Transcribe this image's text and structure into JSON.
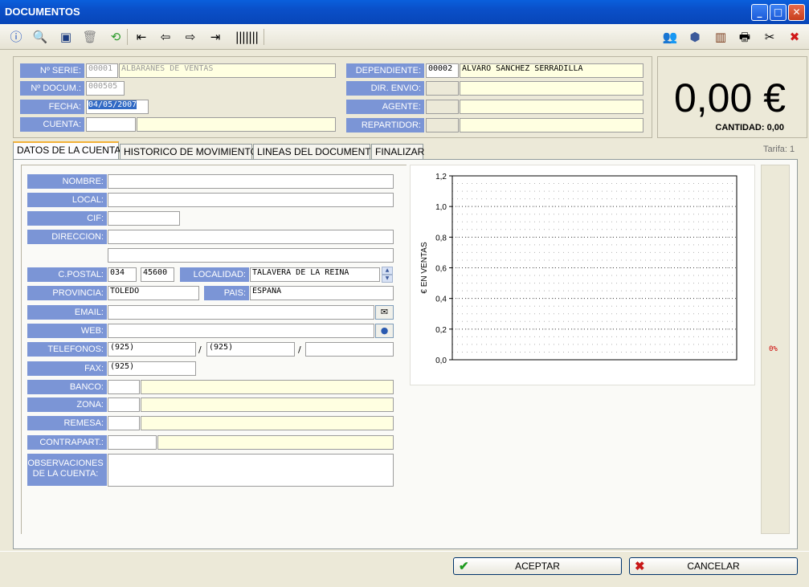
{
  "window": {
    "title": "DOCUMENTOS"
  },
  "header": {
    "serie_label": "Nº SERIE:",
    "serie_code": "00001",
    "serie_name": "ALBARANES DE VENTAS",
    "docum_label": "Nº DOCUM.:",
    "docum_value": "000505",
    "fecha_label": "FECHA:",
    "fecha_value": "04/05/2007",
    "cuenta_label": "CUENTA:",
    "cuenta_code": "",
    "cuenta_name": "",
    "dependiente_label": "DEPENDIENTE:",
    "dependiente_code": "00002",
    "dependiente_name": "ALVARO SANCHEZ SERRADILLA",
    "direnvio_label": "DIR. ENVIO:",
    "agente_label": "AGENTE:",
    "repartidor_label": "REPARTIDOR:"
  },
  "total": {
    "amount": "0,00 €",
    "quantity": "CANTIDAD: 0,00"
  },
  "tabs": [
    {
      "label": "DATOS DE LA CUENTA",
      "active": true
    },
    {
      "label": "HISTORICO DE MOVIMIENTOS"
    },
    {
      "label": "LINEAS DEL DOCUMENTO"
    },
    {
      "label": "FINALIZAR"
    }
  ],
  "tarifa": "Tarifa: 1",
  "form": {
    "nombre_label": "NOMBRE:",
    "local_label": "LOCAL:",
    "cif_label": "CIF:",
    "direccion_label": "DIRECCION:",
    "cpostal_label": "C.POSTAL:",
    "cp1": "034",
    "cp2": "45600",
    "localidad_label": "LOCALIDAD:",
    "localidad_value": "TALAVERA DE LA REINA",
    "provincia_label": "PROVINCIA:",
    "provincia_value": "TOLEDO",
    "pais_label": "PAIS:",
    "pais_value": "ESPAÑA",
    "email_label": "EMAIL:",
    "web_label": "WEB:",
    "telefonos_label": "TELEFONOS:",
    "tel1": "(925)",
    "tel2": "(925)",
    "tel3": "",
    "slash": "/",
    "fax_label": "FAX:",
    "fax_value": "(925)",
    "banco_label": "BANCO:",
    "zona_label": "ZONA:",
    "remesa_label": "REMESA:",
    "contrapart_label": "CONTRAPART.:",
    "observ_label_1": "OBSERVACIONES",
    "observ_label_2": "DE LA CUENTA:"
  },
  "side_percent": "0%",
  "buttons": {
    "ok": "ACEPTAR",
    "cancel": "CANCELAR"
  },
  "chart_data": {
    "type": "line",
    "ylabel": "€ EN VENTAS",
    "xlabel": "",
    "ylim": [
      0,
      1.2
    ],
    "yticks": [
      "0,0",
      "0,2",
      "0,4",
      "0,6",
      "0,8",
      "1,0",
      "1,2"
    ],
    "series": [],
    "grid": true
  }
}
